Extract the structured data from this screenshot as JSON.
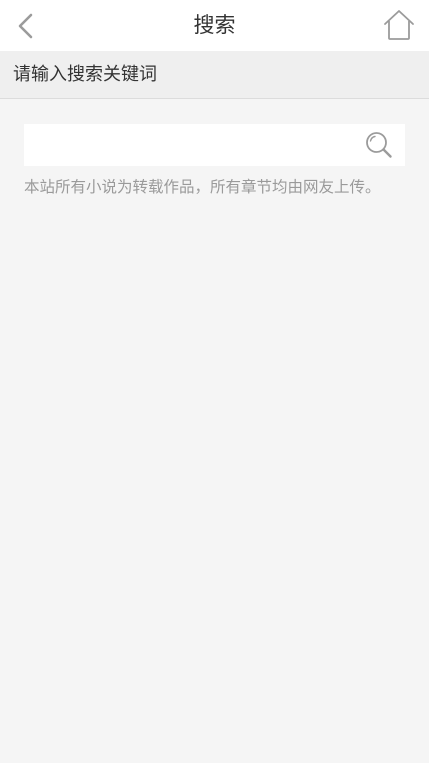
{
  "header": {
    "title": "搜索",
    "back_icon": "chevron-left-icon",
    "home_icon": "home-icon"
  },
  "subbar": {
    "label": "请输入搜索关键词"
  },
  "search": {
    "value": "",
    "icon": "search-icon"
  },
  "notice": {
    "text": "本站所有小说为转载作品，所有章节均由网友上传。"
  },
  "colors": {
    "background": "#f5f5f5",
    "header": "#ffffff",
    "subbar": "#efefef",
    "notice_text": "#9a9a9a",
    "icon_gray": "#9b9b9b"
  }
}
